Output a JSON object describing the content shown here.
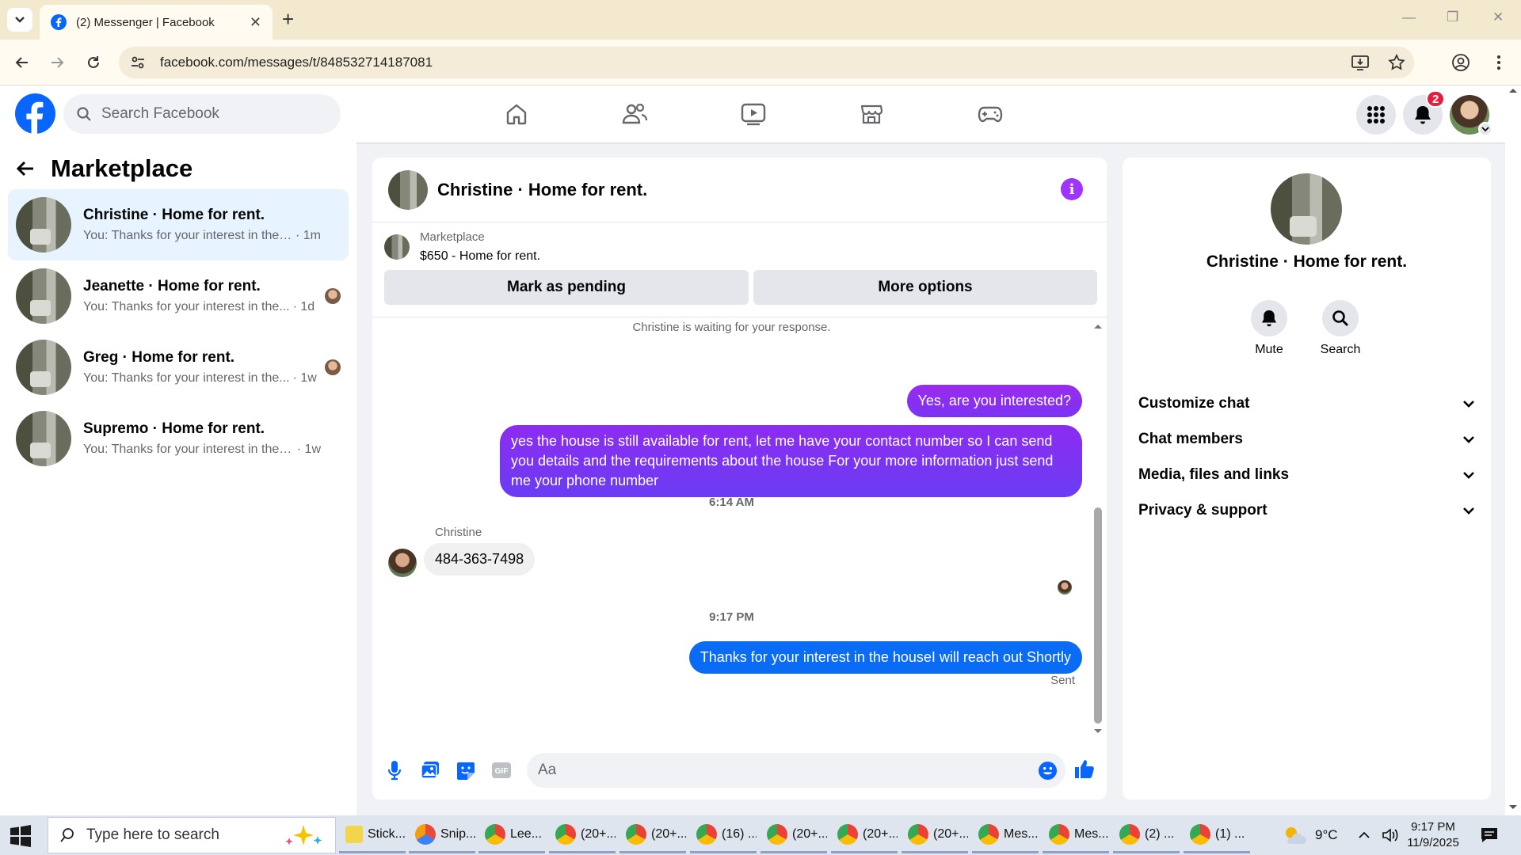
{
  "browser": {
    "tab_title": "(2) Messenger | Facebook",
    "url": "facebook.com/messages/t/848532714187081"
  },
  "fb": {
    "search_placeholder": "Search Facebook",
    "notification_count": "2",
    "nav_icons": [
      "home-icon",
      "friends-icon",
      "video-icon",
      "marketplace-icon",
      "gaming-icon"
    ]
  },
  "left_panel": {
    "title": "Marketplace",
    "conversations": [
      {
        "name": "Christine · Home for rent.",
        "snippet": "You: Thanks for your interest in the h...",
        "time": "· 1m",
        "active": true
      },
      {
        "name": "Jeanette · Home for rent.",
        "snippet": "You: Thanks for your interest in the...",
        "time": "· 1d",
        "active": false
      },
      {
        "name": "Greg · Home for rent.",
        "snippet": "You: Thanks for your interest in the...",
        "time": "· 1w",
        "active": false
      },
      {
        "name": "Supremo · Home for rent.",
        "snippet": "You: Thanks for your interest in the h...",
        "time": "· 1w",
        "active": false
      }
    ]
  },
  "chat": {
    "title": "Christine · Home for rent.",
    "info_icon": "i",
    "listing": {
      "label": "Marketplace",
      "price_title": "$650 - Home for rent.",
      "mark_pending": "Mark as pending",
      "more_options": "More options"
    },
    "waiting_note": "Christine is waiting for your response.",
    "messages": {
      "out1": "Yes, are you interested?",
      "out2": "yes the house is still available for rent, let me have your contact number so I can send you details and the requirements about the house For  your  more  information  just send  me   your  phone  number",
      "time1": "6:14 AM",
      "sender": "Christine",
      "in1": "484-363-7498",
      "time2": "9:17 PM",
      "out3": "Thanks for your interest in the houseI will reach out Shortly",
      "status": "Sent"
    },
    "composer_placeholder": "Aa"
  },
  "right_panel": {
    "name": "Christine · Home for rent.",
    "mute_label": "Mute",
    "search_label": "Search",
    "sections": [
      "Customize chat",
      "Chat members",
      "Media, files and links",
      "Privacy & support"
    ]
  },
  "taskbar": {
    "search_placeholder": "Type here to search",
    "apps": [
      "Stick...",
      "Snip...",
      "Lee...",
      "(20+...",
      "(20+...",
      "(16) ...",
      "(20+...",
      "(20+...",
      "(20+...",
      "Mes...",
      "Mes...",
      "(2) ...",
      "(1) ..."
    ],
    "weather": "9°C",
    "time": "9:17 PM",
    "date": "11/9/2025"
  },
  "colors": {
    "fb_blue": "#0866ff",
    "bubble_purple": "#8a2be2",
    "bubble_blue": "#0a6cf5",
    "active_conv": "#e7f3ff"
  }
}
